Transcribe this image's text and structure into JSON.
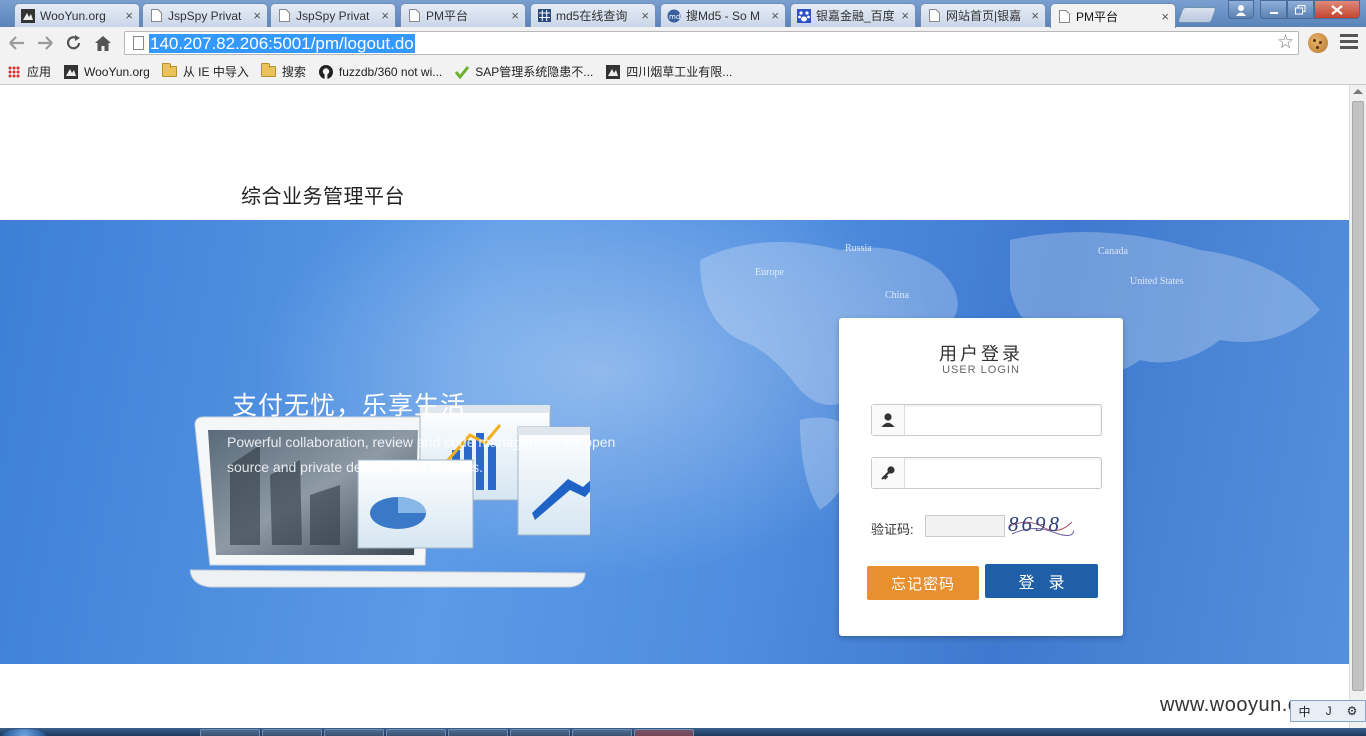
{
  "browser": {
    "tabs": [
      {
        "title": "WooYun.org",
        "icon": "wooyun-favicon"
      },
      {
        "title": "JspSpy Privat",
        "icon": "page-icon"
      },
      {
        "title": "JspSpy Privat",
        "icon": "page-icon"
      },
      {
        "title": "PM平台",
        "icon": "page-icon"
      },
      {
        "title": "md5在线查询",
        "icon": "grid-favicon"
      },
      {
        "title": "搜Md5 - So M",
        "icon": "somd5-favicon"
      },
      {
        "title": "银嘉金融_百度",
        "icon": "baidu-favicon"
      },
      {
        "title": "网站首页|银嘉",
        "icon": "page-icon"
      },
      {
        "title": "PM平台",
        "icon": "page-icon",
        "active": true
      }
    ],
    "tab_close": "×",
    "address": {
      "url": "140.207.82.206:5001/pm/logout.do"
    },
    "bookmarks": [
      {
        "label": "应用",
        "icon": "apps-grid-icon"
      },
      {
        "label": "WooYun.org",
        "icon": "wooyun-favicon"
      },
      {
        "label": "从 IE 中导入",
        "icon": "folder-icon"
      },
      {
        "label": "搜索",
        "icon": "folder-icon"
      },
      {
        "label": "fuzzdb/360 not wi...",
        "icon": "github-icon"
      },
      {
        "label": "SAP管理系统隐患不...",
        "icon": "check-icon"
      },
      {
        "label": "四川烟草工业有限...",
        "icon": "wooyun-favicon"
      }
    ]
  },
  "page": {
    "title": "综合业务管理平台",
    "banner": {
      "slogan": "支付无忧，乐享生活",
      "subslogan": "Powerful collaboration, review and code management for open source and private development projects.",
      "map_labels": [
        "Russia",
        "Europe",
        "China",
        "Canada",
        "United States"
      ]
    },
    "login": {
      "title": "用户登录",
      "subtitle": "USER LOGIN",
      "username": {
        "value": "",
        "placeholder": ""
      },
      "password": {
        "value": "",
        "placeholder": ""
      },
      "captcha_label": "验证码:",
      "captcha_value": "",
      "captcha_image_text": "8698",
      "forgot_button": "忘记密码",
      "login_button": "登录"
    }
  },
  "overlay": {
    "watermark": "www.wooyun.org",
    "ime": [
      "中",
      "J",
      "⚙"
    ]
  },
  "colors": {
    "banner_blue": "#4f8ee0",
    "forgot_orange": "#e88f2f",
    "login_blue": "#1e5fa8",
    "url_highlight": "#3399ff"
  }
}
